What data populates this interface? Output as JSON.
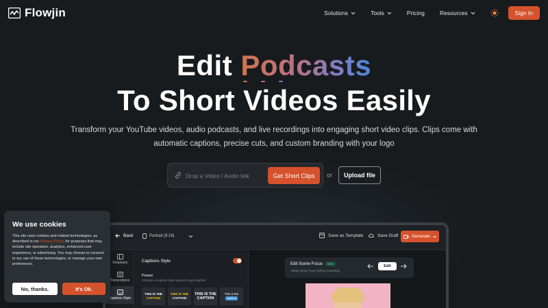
{
  "brand": {
    "name": "Flowjin",
    "accent": "#d5522c",
    "background": "#181b1e"
  },
  "nav": {
    "links": [
      {
        "label": "Solutions",
        "has_dropdown": true
      },
      {
        "label": "Tools",
        "has_dropdown": true
      },
      {
        "label": "Pricing",
        "has_dropdown": false
      },
      {
        "label": "Resources",
        "has_dropdown": true
      }
    ],
    "theme_icon": "sun-icon",
    "signin_label": "Sign In"
  },
  "hero": {
    "line1_prefix": "Edit ",
    "line1_accent": "Podcasts",
    "line2": "To Short Videos Easily",
    "subtitle": "Transform your YouTube videos, audio podcasts, and live recordings into engaging short video clips. Clips come with automatic captions, precise cuts, and custom branding with your logo"
  },
  "input": {
    "placeholder": "Drop a Video / Audio link",
    "value": "",
    "cta_label": "Get Short Clips",
    "or_label": "or",
    "upload_label": "Upload file"
  },
  "app_preview": {
    "back_label": "Back",
    "aspect_label": "Portrait (9:16)",
    "save_template_label": "Save as Template",
    "save_draft_label": "Save Draft",
    "generate_label": "Generate",
    "sidebar": [
      {
        "label": "Templates",
        "icon": "templates-icon",
        "active": false
      },
      {
        "label": "Transcription",
        "icon": "transcription-icon",
        "active": false
      },
      {
        "label": "Captions Style",
        "icon": "captions-icon",
        "active": true
      }
    ],
    "panel_title": "Captions Style",
    "toggle_on": true,
    "preset_label": "Preset",
    "preset_desc": "Choose a caption style preset to get started",
    "presets": [
      {
        "line1": "THIS IS THE",
        "line2": "CAPTION",
        "color1": "#ffffff",
        "color2": "#f5c518"
      },
      {
        "line1": "THIS IS THE",
        "line2": "CAPTION",
        "color1": "#f5c518",
        "color2": "#ffffff"
      },
      {
        "line1": "THIS IS THE",
        "line2": "CAPTION",
        "color1": "#ffffff",
        "color2": "#ffffff"
      },
      {
        "line1": "This is the",
        "line2": "caption",
        "color1": "#ffffff",
        "color2": "#56b6f0"
      }
    ],
    "focus": {
      "title": "Edit Scene Focus",
      "badge": "New",
      "subtitle": "Adjust scene focus before exporting",
      "edit_label": "Edit"
    }
  },
  "cookie": {
    "title": "We use cookies",
    "text_before": "This site uses cookies and related technologies, as described in our ",
    "link_text": "Privacy Policy",
    "text_after": ", for purposes that may include site operation, analytics, enhanced user experience, or advertising. You may choose to consent to our use of these technologies, or manage your own preferences.",
    "decline_label": "No, thanks.",
    "accept_label": "It's Ok."
  }
}
